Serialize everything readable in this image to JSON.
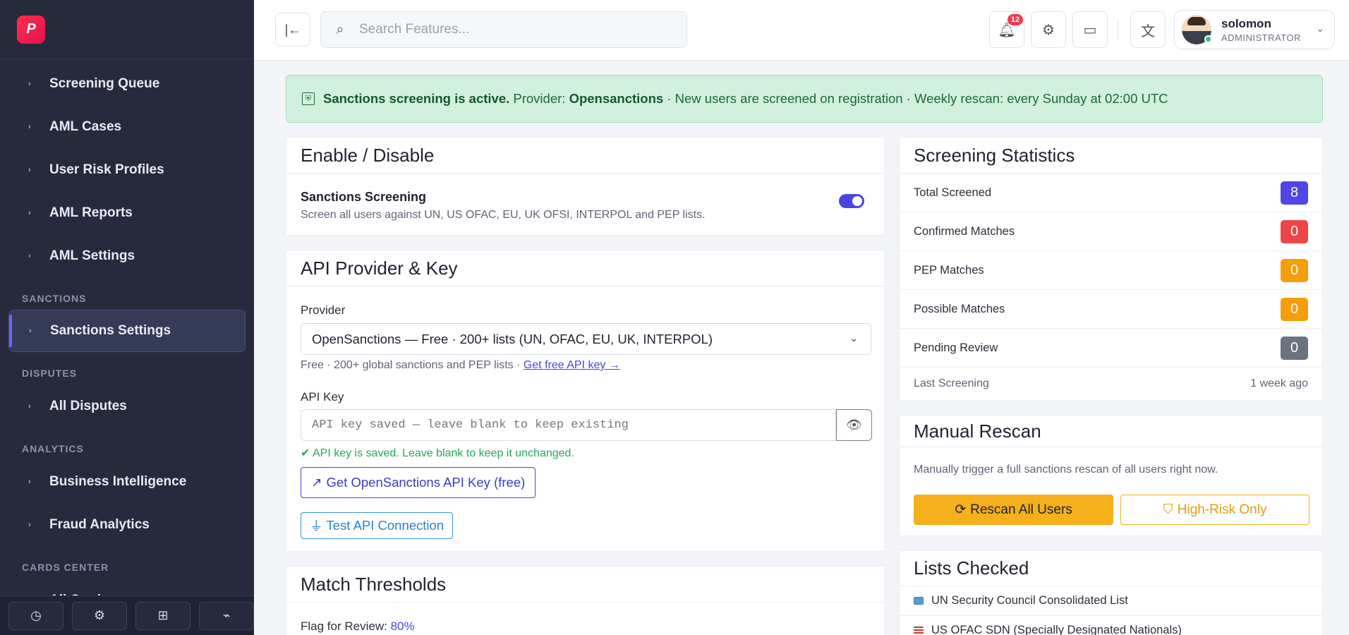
{
  "sidebar": {
    "logo_text": "P",
    "nav_top": [
      "Screening Queue",
      "AML Cases",
      "User Risk Profiles",
      "AML Reports",
      "AML Settings"
    ],
    "sections": [
      {
        "title": "SANCTIONS",
        "items": [
          "Sanctions Settings"
        ]
      },
      {
        "title": "DISPUTES",
        "items": [
          "All Disputes"
        ]
      },
      {
        "title": "ANALYTICS",
        "items": [
          "Business Intelligence",
          "Fraud Analytics"
        ]
      },
      {
        "title": "CARDS CENTER",
        "items": [
          "All Cards"
        ]
      }
    ],
    "active_item": "Sanctions Settings",
    "footer_icons": [
      "clock-icon",
      "settings-icon",
      "add-message-icon",
      "broom-icon"
    ]
  },
  "topbar": {
    "search_placeholder": "Search Features...",
    "notification_count": "12",
    "user": {
      "name": "solomon",
      "role": "ADMINISTRATOR"
    }
  },
  "alert": {
    "bold_text": "Sanctions screening is active.",
    "provider_label": "Provider:",
    "provider_name": "Opensanctions",
    "rest_text": "· New users are screened on registration · Weekly rescan: every Sunday at 02:00 UTC"
  },
  "enable_card": {
    "title": "Enable / Disable",
    "setting_title": "Sanctions Screening",
    "setting_desc": "Screen all users against UN, US OFAC, EU, UK OFSI, INTERPOL and PEP lists.",
    "enabled": true
  },
  "api_card": {
    "title": "API Provider & Key",
    "provider_label": "Provider",
    "provider_value": "OpenSanctions — Free · 200+ lists (UN, OFAC, EU, UK, INTERPOL)",
    "provider_hint": "Free · 200+ global sanctions and PEP lists ·",
    "provider_link": "Get free API key →",
    "key_label": "API Key",
    "key_placeholder": "API key saved — leave blank to keep existing",
    "key_saved_text": "API key is saved. Leave blank to keep it unchanged.",
    "get_key_button": "Get OpenSanctions API Key (free)",
    "test_button": "Test API Connection"
  },
  "thresholds_card": {
    "title": "Match Thresholds",
    "flag_label": "Flag for Review:",
    "flag_value": "80%"
  },
  "stats_card": {
    "title": "Screening Statistics",
    "rows": [
      {
        "label": "Total Screened",
        "value": "8",
        "color": "#4f46e5"
      },
      {
        "label": "Confirmed Matches",
        "value": "0",
        "color": "#ef4444"
      },
      {
        "label": "PEP Matches",
        "value": "0",
        "color": "#f59e0b"
      },
      {
        "label": "Possible Matches",
        "value": "0",
        "color": "#f59e0b"
      },
      {
        "label": "Pending Review",
        "value": "0",
        "color": "#6b7280"
      }
    ],
    "last_label": "Last Screening",
    "last_value": "1 week ago"
  },
  "rescan_card": {
    "title": "Manual Rescan",
    "desc": "Manually trigger a full sanctions rescan of all users right now.",
    "rescan_all": "Rescan All Users",
    "high_risk": "High-Risk Only"
  },
  "lists_card": {
    "title": "Lists Checked",
    "items": [
      "UN Security Council Consolidated List",
      "US OFAC SDN (Specially Designated Nationals)"
    ]
  }
}
